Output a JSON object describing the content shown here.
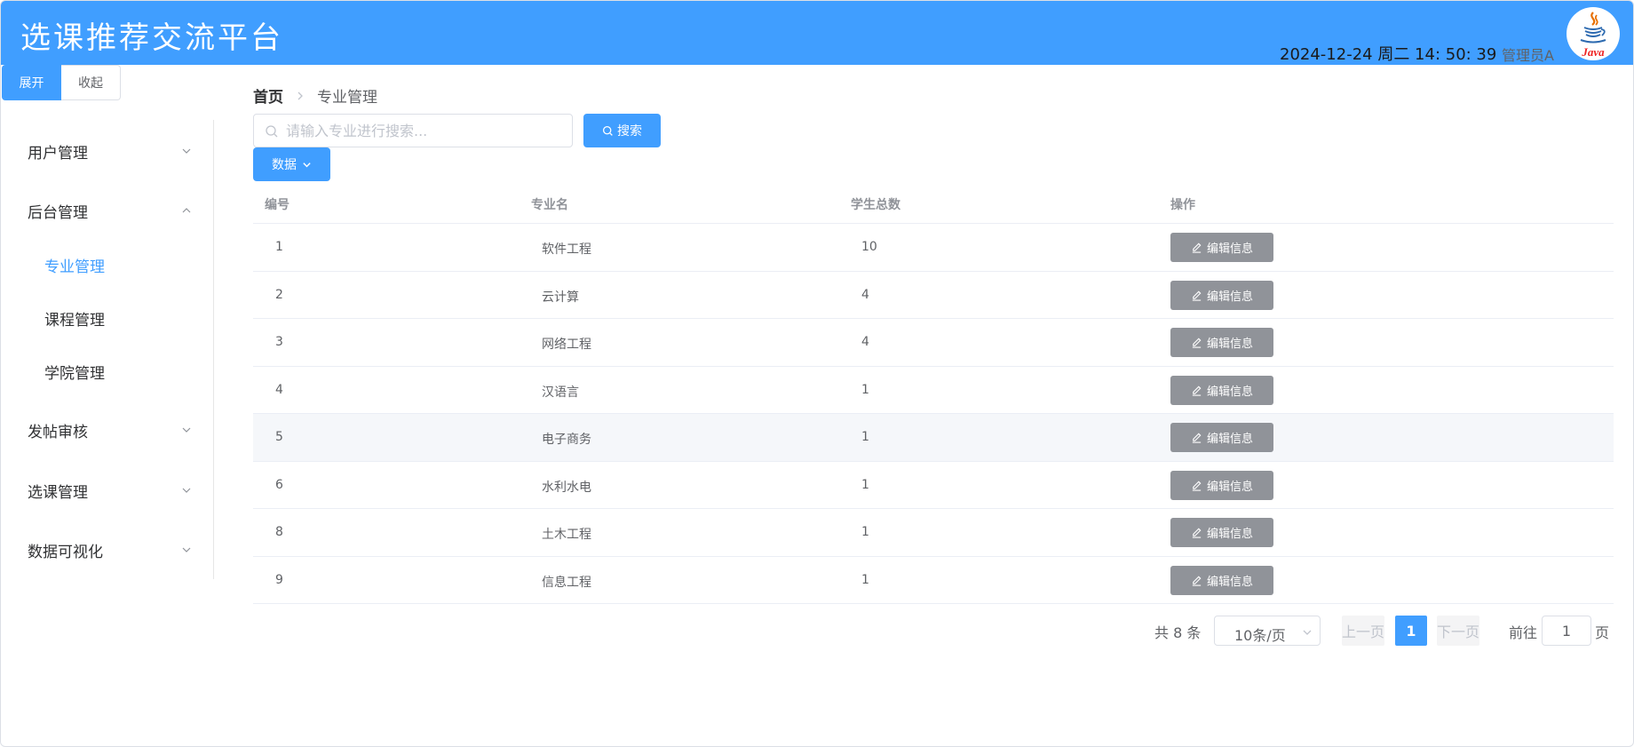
{
  "header": {
    "title": "选课推荐交流平台",
    "datetime": "2024-12-24 周二 14: 50: 39",
    "user": "管理员A",
    "avatar_text": "Java"
  },
  "toggle": {
    "expand": "展开",
    "collapse": "收起"
  },
  "sidebar": {
    "items": [
      {
        "label": "用户管理"
      },
      {
        "label": "后台管理"
      },
      {
        "label": "专业管理"
      },
      {
        "label": "课程管理"
      },
      {
        "label": "学院管理"
      },
      {
        "label": "发帖审核"
      },
      {
        "label": "选课管理"
      },
      {
        "label": "数据可视化"
      }
    ]
  },
  "breadcrumb": {
    "home": "首页",
    "current": "专业管理"
  },
  "search": {
    "placeholder": "请输入专业进行搜索...",
    "button": "搜索"
  },
  "data_button": "数据",
  "table": {
    "headers": [
      "编号",
      "专业名",
      "学生总数",
      "操作"
    ],
    "edit_label": "编辑信息",
    "rows": [
      {
        "id": "1",
        "name": "软件工程",
        "count": "10"
      },
      {
        "id": "2",
        "name": "云计算",
        "count": "4"
      },
      {
        "id": "3",
        "name": "网络工程",
        "count": "4"
      },
      {
        "id": "4",
        "name": "汉语言",
        "count": "1"
      },
      {
        "id": "5",
        "name": "电子商务",
        "count": "1"
      },
      {
        "id": "6",
        "name": "水利水电",
        "count": "1"
      },
      {
        "id": "8",
        "name": "土木工程",
        "count": "1"
      },
      {
        "id": "9",
        "name": "信息工程",
        "count": "1"
      }
    ]
  },
  "pagination": {
    "total": "共 8 条",
    "page_size": "10条/页",
    "prev": "上一页",
    "current": "1",
    "next": "下一页",
    "goto": "前往",
    "goto_value": "1",
    "page_suffix": "页"
  },
  "colors": {
    "primary": "#409eff",
    "edit_button": "#909399"
  }
}
